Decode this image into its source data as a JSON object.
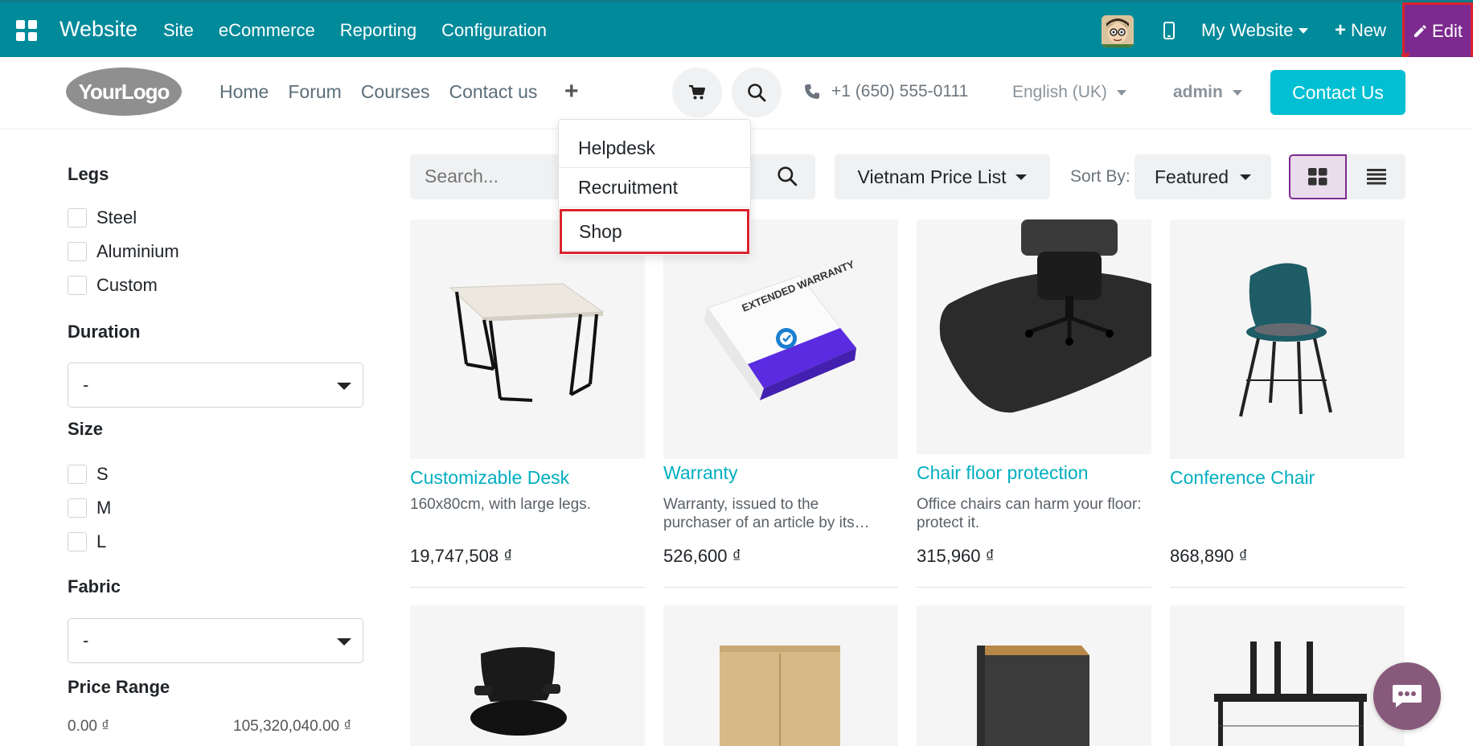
{
  "topbar": {
    "brand": "Website",
    "menu": [
      "Site",
      "eCommerce",
      "Reporting",
      "Configuration"
    ],
    "my_website": "My Website",
    "new_label": "New",
    "edit_label": "Edit",
    "bg_color": "#018a9a",
    "edit_color": "#7d2a8f"
  },
  "header": {
    "logo_text": "YourLogo",
    "nav": [
      "Home",
      "Forum",
      "Courses",
      "Contact us"
    ],
    "phone": "+1 (650) 555-0111",
    "language": "English (UK)",
    "user": "admin",
    "contact_button": "Contact Us",
    "accent_color": "#02bfd3"
  },
  "dropdown": {
    "items": [
      "Helpdesk",
      "Recruitment",
      "Shop"
    ],
    "highlighted": "Shop"
  },
  "filters": {
    "legs_title": "Legs",
    "legs_options": [
      "Steel",
      "Aluminium",
      "Custom"
    ],
    "duration_title": "Duration",
    "duration_value": "-",
    "size_title": "Size",
    "size_options": [
      "S",
      "M",
      "L"
    ],
    "fabric_title": "Fabric",
    "fabric_value": "-",
    "price_title": "Price Range",
    "price_min": "0.00 ₫",
    "price_max": "105,320,040.00 ₫"
  },
  "toolbar": {
    "search_placeholder": "Search...",
    "pricelist": "Vietnam Price List",
    "sort_label": "Sort By:",
    "sort_value": "Featured"
  },
  "products": [
    {
      "name": "Customizable Desk",
      "desc": "160x80cm, with large legs.",
      "price": "19,747,508 ₫"
    },
    {
      "name": "Warranty",
      "desc": "Warranty, issued to the purchaser of an article by its…",
      "price": "526,600 ₫"
    },
    {
      "name": "Chair floor protection",
      "desc": "Office chairs can harm your floor: protect it.",
      "price": "315,960 ₫"
    },
    {
      "name": "Conference Chair",
      "desc": "",
      "price": "868,890 ₫"
    }
  ],
  "warranty_box_text": "EXTENDED WARRANTY",
  "icons": {
    "apps": "apps-grid-icon",
    "cart": "cart-icon",
    "search": "search-icon",
    "phone": "phone-icon",
    "chat": "chat-icon"
  }
}
